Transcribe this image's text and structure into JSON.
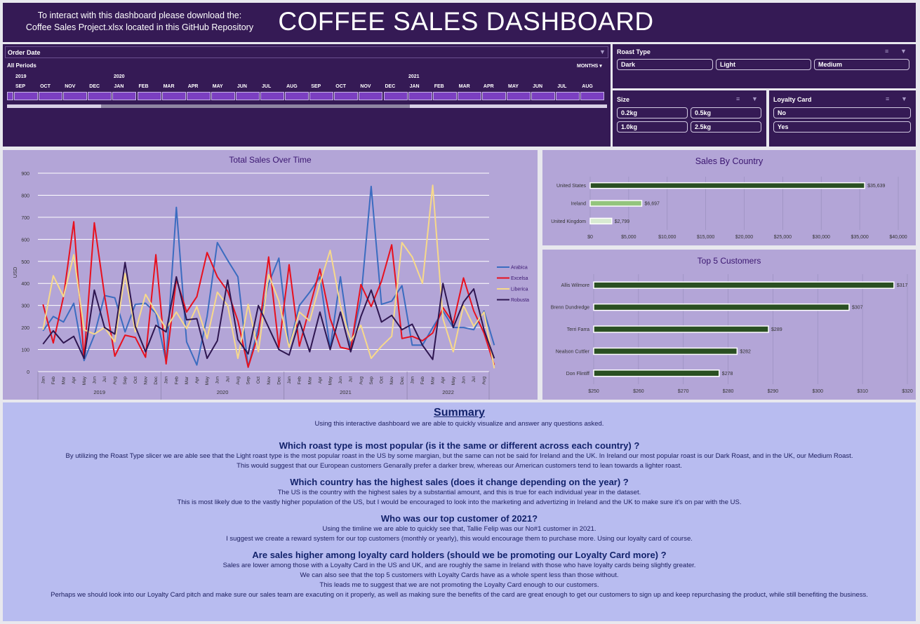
{
  "header": {
    "note_line1": "To interact with this dashboard please download the:",
    "note_line2": "Coffee Sales Project.xlsx located in this GitHub Repository",
    "title": "COFFEE SALES DASHBOARD"
  },
  "timeline": {
    "title": "Order Date",
    "period": "All Periods",
    "unit": "MONTHS",
    "years": [
      "2019",
      "2020",
      "2021"
    ],
    "months": [
      "SEP",
      "OCT",
      "NOV",
      "DEC",
      "JAN",
      "FEB",
      "MAR",
      "APR",
      "MAY",
      "JUN",
      "JUL",
      "AUG",
      "SEP",
      "OCT",
      "NOV",
      "DEC",
      "JAN",
      "FEB",
      "MAR",
      "APR",
      "MAY",
      "JUN",
      "JUL",
      "AUG"
    ]
  },
  "slicers": {
    "roast": {
      "title": "Roast Type",
      "options": [
        "Dark",
        "Light",
        "Medium"
      ]
    },
    "size": {
      "title": "Size",
      "options": [
        "0.2kg",
        "0.5kg",
        "1.0kg",
        "2.5kg"
      ]
    },
    "loyalty": {
      "title": "Loyalty Card",
      "options": [
        "No",
        "Yes"
      ]
    }
  },
  "colors": {
    "arabica": "#3b6cc0",
    "excelsa": "#e8101e",
    "liberica": "#f7d98a",
    "robusta": "#2e1650",
    "bar_dark": "#2a4f22",
    "bar_mid": "#93c47d",
    "bar_light": "#d8ead2"
  },
  "chart_data": [
    {
      "type": "line",
      "title": "Total Sales Over Time",
      "ylabel": "USD",
      "ylim": [
        0,
        900
      ],
      "yticks": [
        0,
        100,
        200,
        300,
        400,
        500,
        600,
        700,
        800,
        900
      ],
      "months": [
        "Jan",
        "Feb",
        "Mar",
        "Apr",
        "May",
        "Jun",
        "Jul",
        "Aug",
        "Sep",
        "Oct",
        "Nov",
        "Dec",
        "Jan",
        "Feb",
        "Mar",
        "Apr",
        "May",
        "Jun",
        "Jul",
        "Aug",
        "Sep",
        "Oct",
        "Nov",
        "Dec",
        "Jan",
        "Feb",
        "Mar",
        "Apr",
        "May",
        "Jun",
        "Jul",
        "Aug",
        "Sep",
        "Oct",
        "Nov",
        "Dec",
        "Jan",
        "Feb",
        "Mar",
        "Apr",
        "May",
        "Jun",
        "Jul",
        "Aug"
      ],
      "years": [
        "2019",
        "2020",
        "2021",
        "2022"
      ],
      "series": [
        {
          "name": "Arabica",
          "values": [
            185,
            250,
            225,
            310,
            50,
            165,
            345,
            335,
            180,
            305,
            310,
            265,
            45,
            745,
            135,
            30,
            250,
            585,
            505,
            430,
            20,
            200,
            400,
            515,
            110,
            300,
            360,
            430,
            105,
            430,
            110,
            330,
            840,
            305,
            320,
            390,
            120,
            120,
            200,
            275,
            200,
            200,
            190,
            275,
            120
          ]
        },
        {
          "name": "Excelsa",
          "values": [
            305,
            130,
            340,
            680,
            60,
            675,
            345,
            70,
            165,
            155,
            65,
            530,
            35,
            420,
            270,
            340,
            540,
            430,
            365,
            230,
            20,
            170,
            520,
            110,
            485,
            115,
            290,
            465,
            240,
            110,
            100,
            395,
            295,
            410,
            575,
            150,
            160,
            140,
            175,
            290,
            220,
            425,
            275,
            175,
            30
          ]
        },
        {
          "name": "Liberica",
          "values": [
            190,
            435,
            340,
            530,
            190,
            170,
            200,
            135,
            445,
            180,
            350,
            270,
            195,
            270,
            195,
            295,
            150,
            360,
            300,
            60,
            305,
            90,
            440,
            320,
            110,
            270,
            230,
            400,
            550,
            300,
            140,
            210,
            60,
            115,
            160,
            585,
            520,
            400,
            845,
            240,
            90,
            300,
            205,
            270,
            15
          ]
        },
        {
          "name": "Robusta",
          "values": [
            125,
            185,
            130,
            160,
            60,
            370,
            200,
            170,
            495,
            205,
            90,
            210,
            180,
            430,
            235,
            240,
            60,
            140,
            415,
            145,
            80,
            300,
            200,
            100,
            75,
            230,
            90,
            270,
            100,
            270,
            90,
            250,
            370,
            225,
            255,
            190,
            215,
            120,
            55,
            400,
            200,
            315,
            375,
            190,
            60
          ]
        }
      ]
    },
    {
      "type": "bar",
      "title": "Sales By Country",
      "categories": [
        "United States",
        "Ireland",
        "United Kingdom"
      ],
      "values": [
        35639,
        6697,
        2799
      ],
      "labels": [
        "$35,639",
        "$6,697",
        "$2,799"
      ],
      "xlim": [
        0,
        40000
      ],
      "xticks": [
        "$0",
        "$5,000",
        "$10,000",
        "$15,000",
        "$20,000",
        "$25,000",
        "$30,000",
        "$35,000",
        "$40,000"
      ]
    },
    {
      "type": "bar",
      "title": "Top 5 Customers",
      "categories": [
        "Allis Wilmore",
        "Brenn Dundredge",
        "Terri Farra",
        "Nealson Cuttler",
        "Don Flintiff"
      ],
      "values": [
        317,
        307,
        289,
        282,
        278
      ],
      "labels": [
        "$317",
        "$307",
        "$289",
        "$282",
        "$278"
      ],
      "xlim": [
        250,
        320
      ],
      "xticks": [
        "$250",
        "$260",
        "$270",
        "$280",
        "$290",
        "$300",
        "$310",
        "$320"
      ]
    }
  ],
  "summary": {
    "heading": "Summary",
    "intro": "Using this interactive dashboard we are able to quickly visualize and answer any questions asked.",
    "q1": "Which roast type is most popular (is it the same or different across each country) ?",
    "a1_1": "By utilizing the Roast Type slicer we are able see that the Light roast type is the most popular roast in the US by some margian, but the same can not be said for Ireland and the UK. In Ireland our most popular roast is our Dark Roast, and in the UK, our Medium Roast.",
    "a1_2": "This would suggest that our European customers Genarally prefer a darker brew, whereas our American customers tend to lean towards a lighter roast.",
    "q2": "Which country has the highest sales (does it change depending on the year) ?",
    "a2_1": "The US is the country with the highest sales by a substantial amount, and this is true for each individual year in the dataset.",
    "a2_2": "This is most likely due to the vastly higher population of the US, but I would be encouraged to look into the marketing and advertizing in Ireland and the UK to make sure it's on par with the US.",
    "q3": "Who was our top customer of 2021?",
    "a3_1": "Using the timline we are able to quickly see that, Tallie Felip was our No#1 customer in 2021.",
    "a3_2": "I suggest we create a reward system for our top customers (monthly or yearly), this would encourage them to purchase more. Using our loyalty card of course.",
    "q4": "Are sales higher among loyalty card holders (should we be promoting our Loyalty Card more) ?",
    "a4_1": "Sales are lower among those with a Loyalty Card in the US and UK, and are roughly the same in Ireland with those who have loyalty cards being slightly greater.",
    "a4_2": "We can also see that the top 5 customers with Loyalty Cards have as a whole spent less than those without.",
    "a4_3": "This leads me to suggest that we are not promoting the Loyalty Card enough to our customers.",
    "a4_4": "Perhaps we should look into our Loyalty Card pitch and make sure our sales team are exacuting on it properly, as well as making sure the benefits of the card are great enough to get our customers to sign up and keep repurchasing the product, while still benefiting the business."
  }
}
